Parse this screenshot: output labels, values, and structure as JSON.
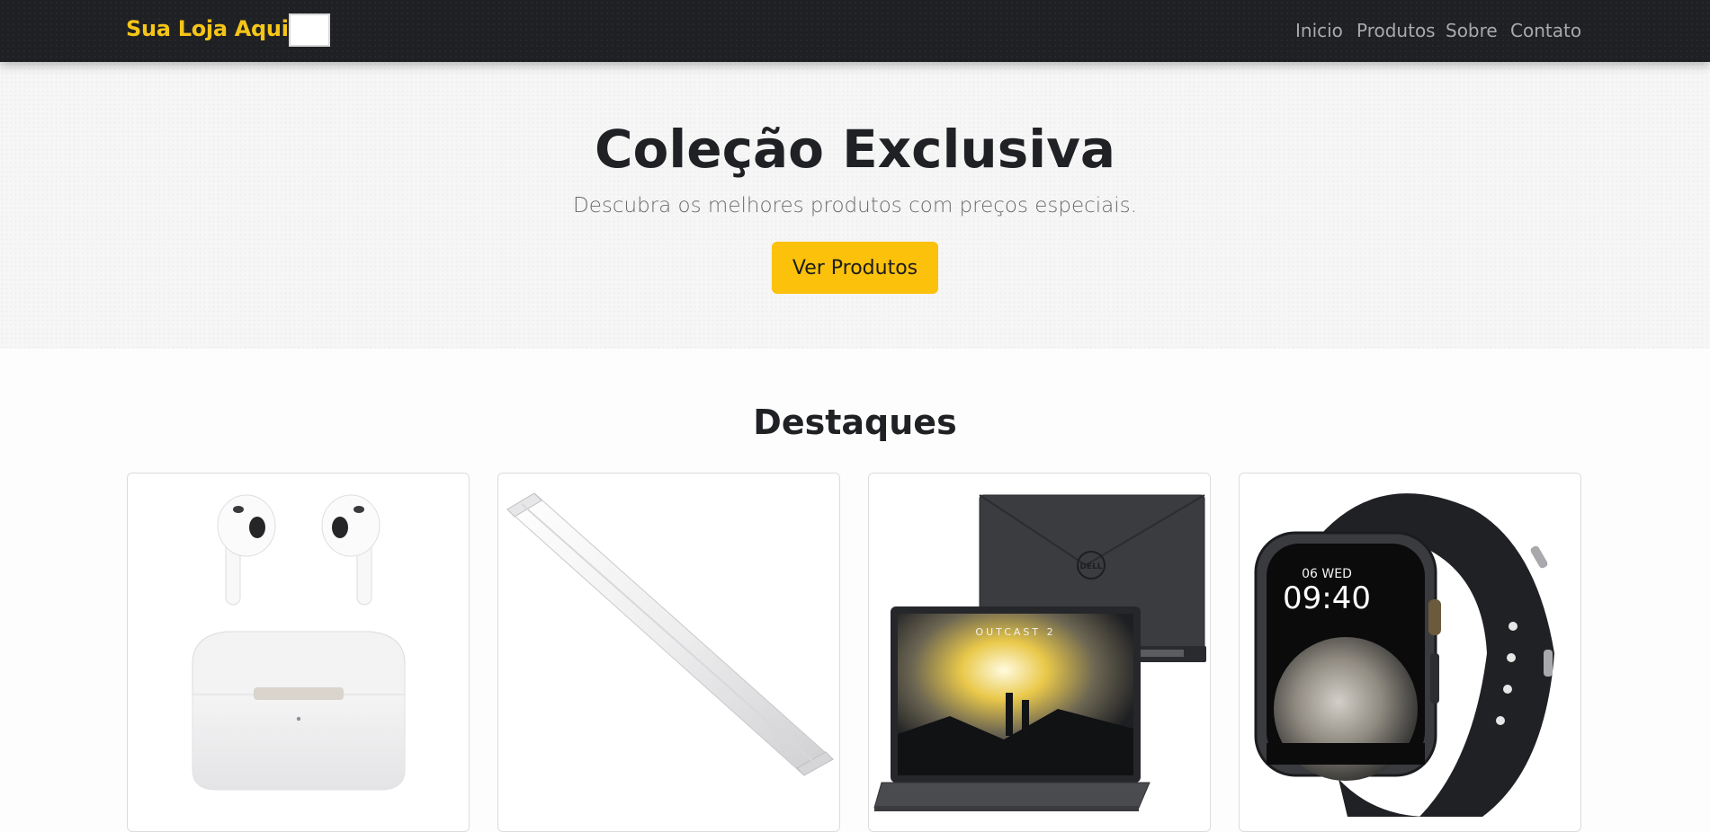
{
  "navbar": {
    "brand": "Sua Loja Aqui",
    "links": [
      "Inicio",
      "Produtos",
      "Sobre",
      "Contato"
    ]
  },
  "hero": {
    "title": "Coleção Exclusiva",
    "subtitle": "Descubra os melhores produtos com preços especiais.",
    "cta_label": "Ver Produtos"
  },
  "featured": {
    "title": "Destaques",
    "products": [
      {
        "image": "earbuds-image"
      },
      {
        "image": "led-light-bar-image"
      },
      {
        "image": "laptop-image",
        "logo": "DELL",
        "screen_text": "OUTCAST 2"
      },
      {
        "image": "smartwatch-image",
        "date": "06 WED",
        "time": "09:40"
      }
    ]
  },
  "colors": {
    "navbar_bg": "#1f2024",
    "brand": "#f5c518",
    "accent": "#fbc10b",
    "nav_link": "#a9a9ad"
  }
}
